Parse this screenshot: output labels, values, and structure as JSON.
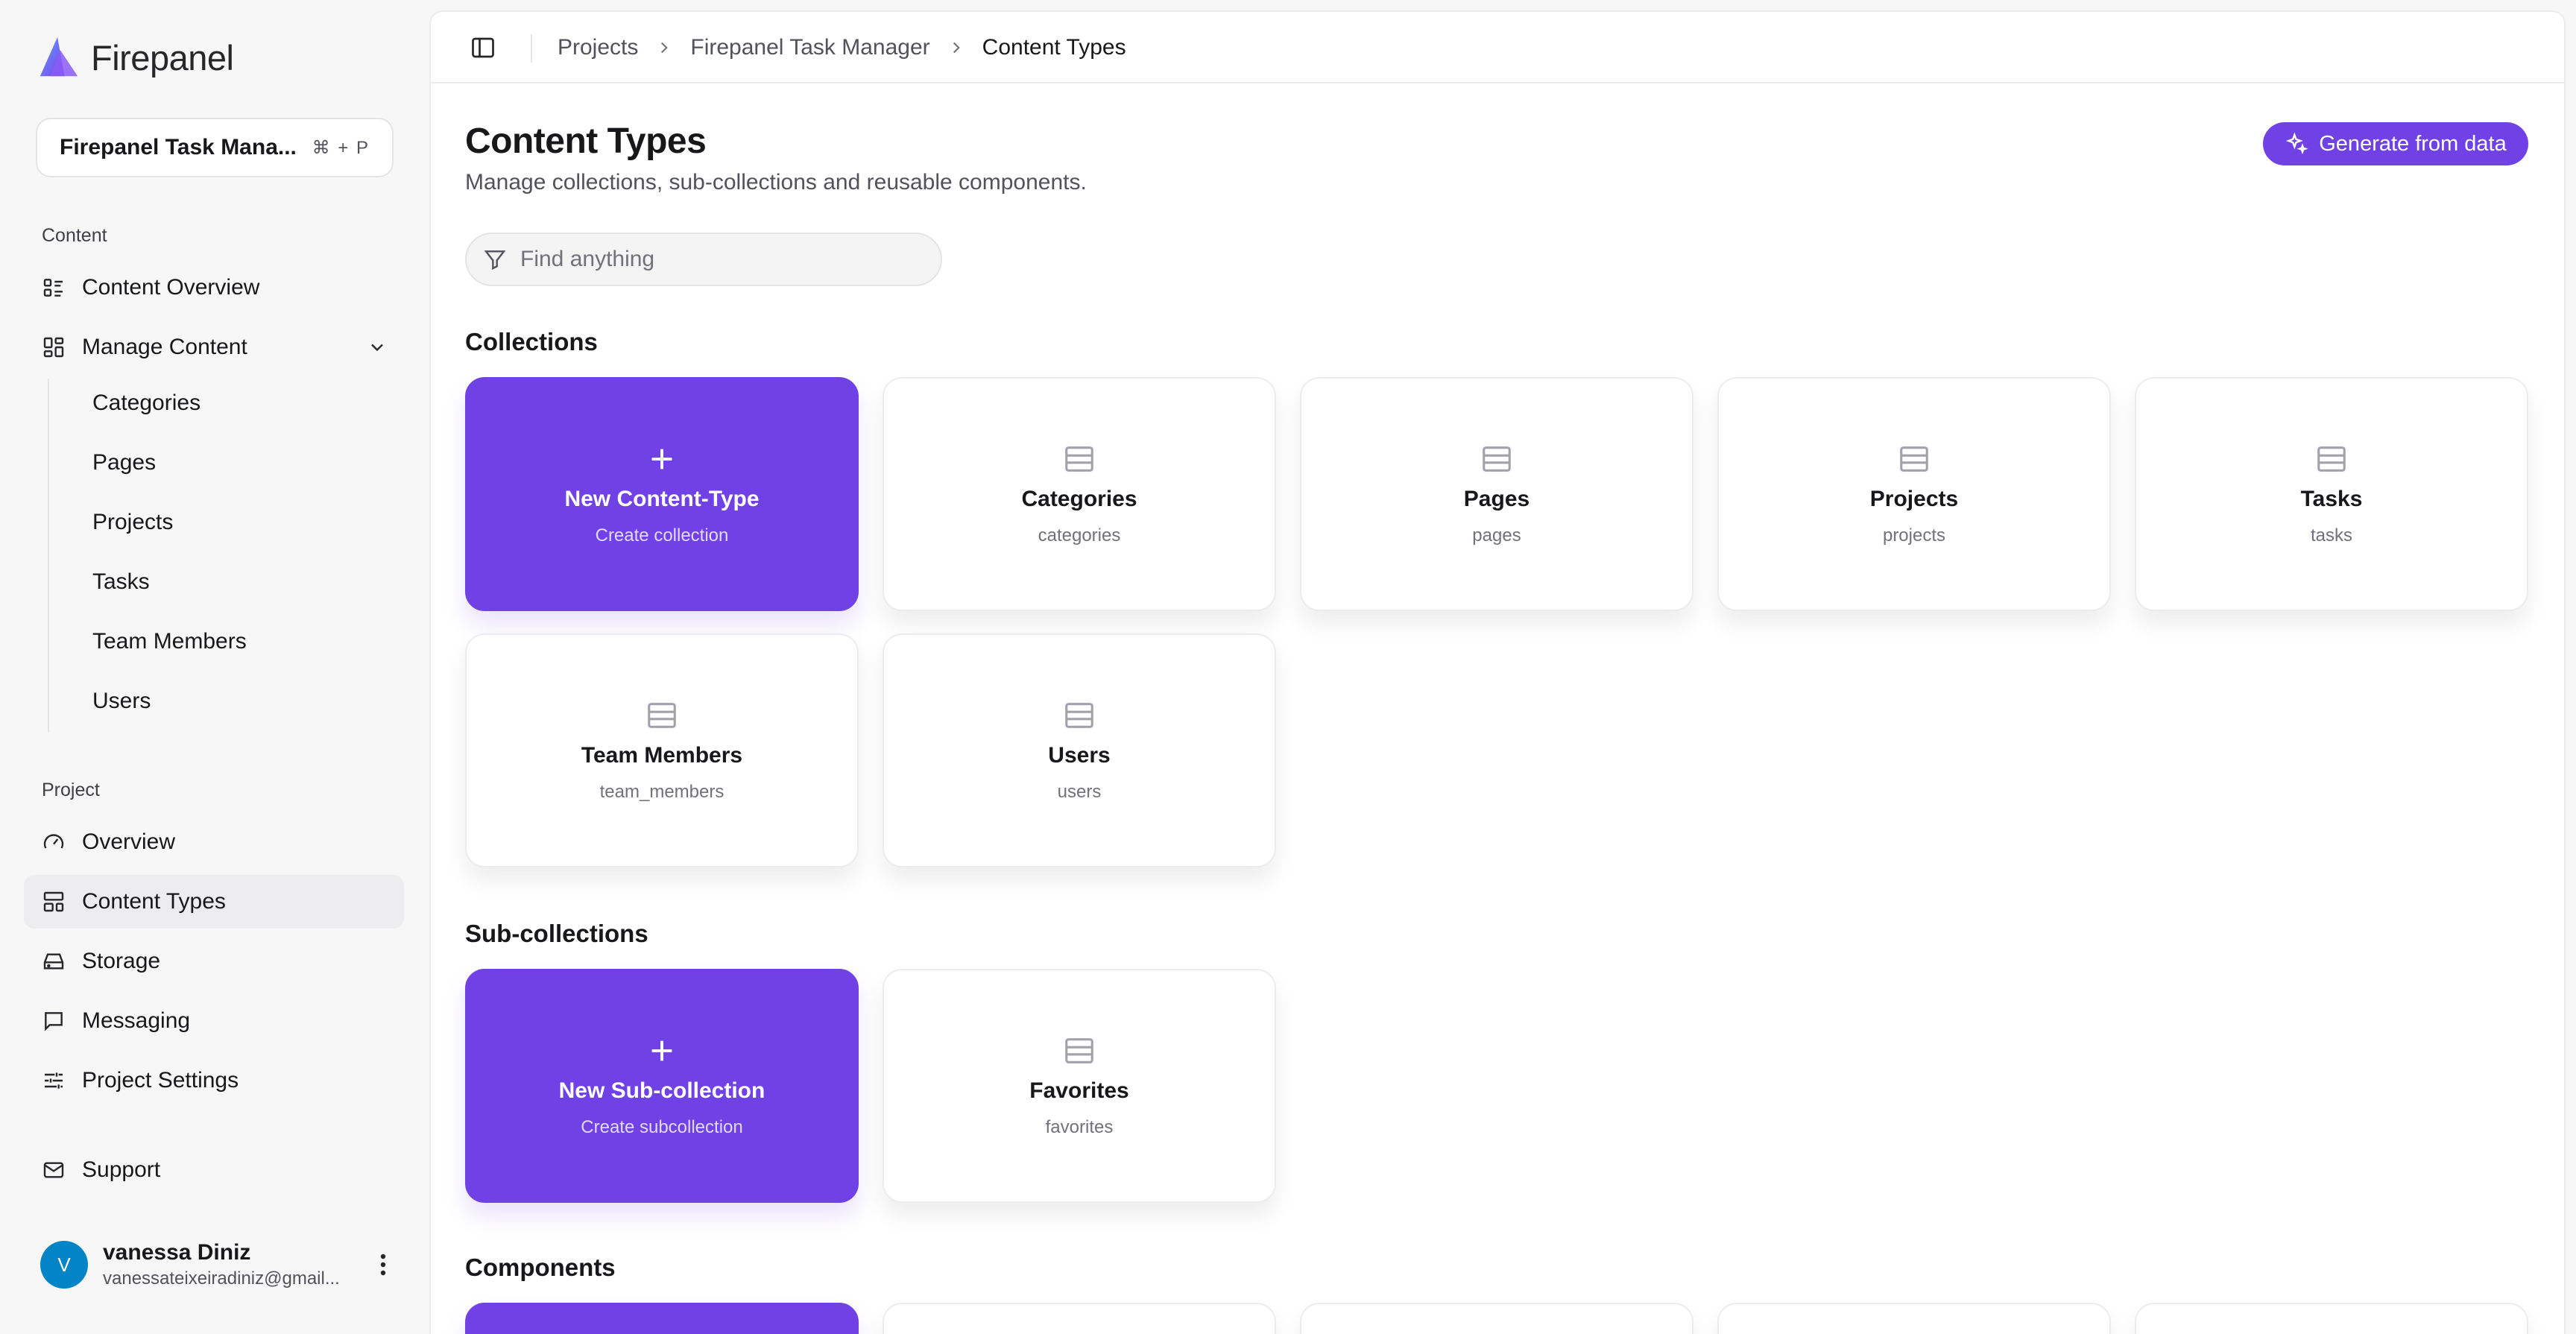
{
  "brand": {
    "name": "Firepanel"
  },
  "project_switcher": {
    "name": "Firepanel Task Mana...",
    "shortcut": "⌘ + P"
  },
  "sidebar": {
    "content_label": "Content",
    "content_items": [
      {
        "label": "Content Overview",
        "icon": "list-icon"
      },
      {
        "label": "Manage Content",
        "icon": "dashboard-icon",
        "expanded": true
      }
    ],
    "manage_children": [
      "Categories",
      "Pages",
      "Projects",
      "Tasks",
      "Team Members",
      "Users"
    ],
    "project_label": "Project",
    "project_items": [
      {
        "label": "Overview",
        "icon": "gauge-icon"
      },
      {
        "label": "Content Types",
        "icon": "layout-icon",
        "active": true
      },
      {
        "label": "Storage",
        "icon": "hard-drive-icon"
      },
      {
        "label": "Messaging",
        "icon": "message-icon"
      },
      {
        "label": "Project Settings",
        "icon": "sliders-icon"
      }
    ],
    "support": {
      "label": "Support",
      "icon": "mail-icon"
    }
  },
  "user": {
    "initial": "V",
    "name": "vanessa Diniz",
    "email": "vanessateixeiradiniz@gmail..."
  },
  "breadcrumb": [
    "Projects",
    "Firepanel Task Manager",
    "Content Types"
  ],
  "header": {
    "title": "Content Types",
    "subtitle": "Manage collections, sub-collections and reusable components.",
    "generate_label": "Generate from data"
  },
  "search": {
    "placeholder": "Find anything",
    "value": ""
  },
  "collections": {
    "title": "Collections",
    "new_card": {
      "title": "New Content-Type",
      "subtitle": "Create collection"
    },
    "items": [
      {
        "title": "Categories",
        "slug": "categories"
      },
      {
        "title": "Pages",
        "slug": "pages"
      },
      {
        "title": "Projects",
        "slug": "projects"
      },
      {
        "title": "Tasks",
        "slug": "tasks"
      },
      {
        "title": "Team Members",
        "slug": "team_members"
      },
      {
        "title": "Users",
        "slug": "users"
      }
    ]
  },
  "subcollections": {
    "title": "Sub-collections",
    "new_card": {
      "title": "New Sub-collection",
      "subtitle": "Create subcollection"
    },
    "items": [
      {
        "title": "Favorites",
        "slug": "favorites"
      }
    ]
  },
  "components": {
    "title": "Components"
  },
  "colors": {
    "accent": "#7042e6",
    "avatar": "#0284c7",
    "sidebar_bg": "#f7f7f8"
  }
}
